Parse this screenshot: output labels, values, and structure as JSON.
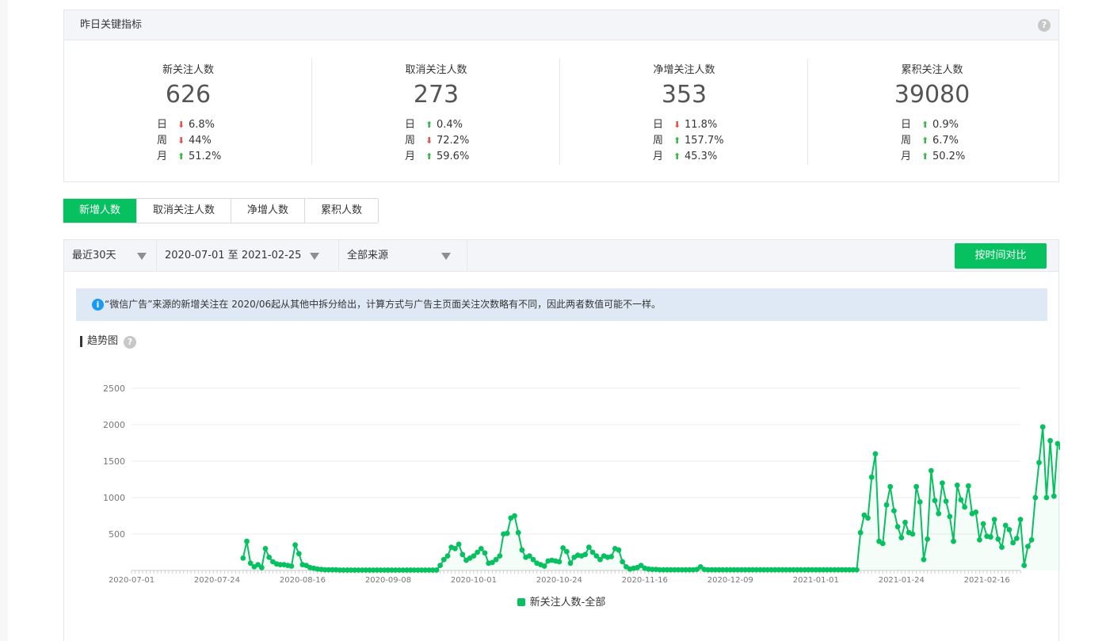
{
  "kpi": {
    "title": "昨日关键指标",
    "help": "?",
    "cards": [
      {
        "label": "新关注人数",
        "value": "626",
        "rows": [
          {
            "period": "日",
            "dir": "down",
            "pct": "6.8%"
          },
          {
            "period": "周",
            "dir": "down",
            "pct": "44%"
          },
          {
            "period": "月",
            "dir": "up",
            "pct": "51.2%"
          }
        ]
      },
      {
        "label": "取消关注人数",
        "value": "273",
        "rows": [
          {
            "period": "日",
            "dir": "up",
            "pct": "0.4%"
          },
          {
            "period": "周",
            "dir": "down",
            "pct": "72.2%"
          },
          {
            "period": "月",
            "dir": "up",
            "pct": "59.6%"
          }
        ]
      },
      {
        "label": "净增关注人数",
        "value": "353",
        "rows": [
          {
            "period": "日",
            "dir": "down",
            "pct": "11.8%"
          },
          {
            "period": "周",
            "dir": "up",
            "pct": "157.7%"
          },
          {
            "period": "月",
            "dir": "up",
            "pct": "45.3%"
          }
        ]
      },
      {
        "label": "累积关注人数",
        "value": "39080",
        "rows": [
          {
            "period": "日",
            "dir": "up",
            "pct": "0.9%"
          },
          {
            "period": "周",
            "dir": "up",
            "pct": "6.7%"
          },
          {
            "period": "月",
            "dir": "up",
            "pct": "50.2%"
          }
        ]
      }
    ]
  },
  "tabs": [
    "新增人数",
    "取消关注人数",
    "净增人数",
    "累积人数"
  ],
  "filters": {
    "range": "最近30天",
    "dates": "2020-07-01 至 2021-02-25",
    "source": "全部来源",
    "compare": "按时间对比"
  },
  "notice": {
    "icon": "i",
    "text": "“微信广告”来源的新增关注在 2020/06起从其他中拆分给出，计算方式与广告主页面关注次数略有不同，因此两者数值可能不一样。"
  },
  "section": {
    "title": "趋势图",
    "help": "?"
  },
  "colors": {
    "accent": "#07c160",
    "down": "#e15151",
    "up": "#3ab54a",
    "info": "#1a9af3"
  },
  "chart_data": {
    "type": "line",
    "ylim": [
      0,
      2500
    ],
    "yticks": [
      0,
      500,
      1000,
      1500,
      2000,
      2500
    ],
    "ytick_labels": [
      "",
      "500",
      "1000",
      "1500",
      "2000",
      "2500"
    ],
    "xtick_labels": [
      "2020-07-01",
      "2020-07-24",
      "2020-08-16",
      "2020-09-08",
      "2020-10-01",
      "2020-10-24",
      "2020-11-16",
      "2020-12-09",
      "2021-01-01",
      "2021-01-24",
      "2021-02-16"
    ],
    "xtick_index": [
      0,
      23,
      46,
      69,
      92,
      115,
      138,
      161,
      184,
      207,
      230
    ],
    "num_days": 240,
    "first_point_index": 30,
    "series": [
      {
        "name": "新关注人数-全部",
        "values": [
          170,
          400,
          100,
          50,
          80,
          40,
          300,
          180,
          120,
          90,
          80,
          80,
          70,
          60,
          350,
          230,
          80,
          70,
          40,
          30,
          20,
          15,
          10,
          10,
          10,
          10,
          5,
          5,
          5,
          5,
          5,
          5,
          5,
          5,
          5,
          5,
          5,
          5,
          5,
          5,
          5,
          5,
          5,
          5,
          5,
          5,
          5,
          5,
          5,
          5,
          5,
          5,
          5,
          70,
          150,
          200,
          320,
          300,
          360,
          220,
          140,
          170,
          200,
          250,
          300,
          240,
          100,
          110,
          150,
          200,
          500,
          510,
          720,
          750,
          520,
          280,
          180,
          200,
          150,
          100,
          80,
          60,
          130,
          140,
          130,
          120,
          310,
          260,
          100,
          180,
          210,
          200,
          220,
          320,
          250,
          200,
          150,
          200,
          180,
          190,
          300,
          280,
          120,
          50,
          20,
          30,
          40,
          70,
          30,
          20,
          15,
          15,
          10,
          10,
          10,
          10,
          10,
          10,
          10,
          10,
          10,
          10,
          15,
          50,
          15,
          10,
          10,
          10,
          10,
          10,
          10,
          10,
          10,
          10,
          10,
          10,
          10,
          10,
          10,
          10,
          10,
          10,
          10,
          10,
          10,
          10,
          10,
          10,
          10,
          10,
          10,
          10,
          10,
          10,
          10,
          10,
          10,
          10,
          10,
          10,
          10,
          10,
          10,
          10,
          10,
          10,
          520,
          760,
          720,
          1280,
          1600,
          400,
          370,
          900,
          1150,
          820,
          600,
          450,
          660,
          520,
          500,
          1150,
          940,
          150,
          430,
          1370,
          960,
          780,
          1200,
          950,
          740,
          400,
          1170,
          970,
          870,
          1160,
          780,
          800,
          420,
          640,
          470,
          460,
          700,
          430,
          320,
          620,
          560,
          380,
          440,
          700,
          70,
          330,
          420,
          1000,
          1480,
          1970,
          1000,
          1780,
          1020,
          1740,
          1680,
          1120,
          710,
          780,
          800,
          510,
          630,
          680,
          630
        ]
      }
    ]
  }
}
